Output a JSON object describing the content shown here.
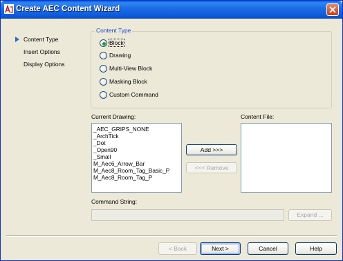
{
  "window": {
    "title": "Create AEC Content Wizard"
  },
  "steps": [
    {
      "label": "Content Type",
      "active": true
    },
    {
      "label": "Insert Options",
      "active": false
    },
    {
      "label": "Display Options",
      "active": false
    }
  ],
  "content_type": {
    "legend": "Content Type",
    "options": [
      {
        "label": "Block",
        "selected": true
      },
      {
        "label": "Drawing",
        "selected": false
      },
      {
        "label": "Multi-View Block",
        "selected": false
      },
      {
        "label": "Masking Block",
        "selected": false
      },
      {
        "label": "Custom Command",
        "selected": false
      }
    ]
  },
  "current_drawing": {
    "label": "Current Drawing:",
    "items": [
      "_AEC_GRIPS_NONE",
      "_ArchTick",
      "_Dot",
      "_Open90",
      "_Small",
      "M_Aec6_Arrow_Bar",
      "M_Aec8_Room_Tag_Basic_P",
      "M_Aec8_Room_Tag_P"
    ]
  },
  "content_file": {
    "label": "Content File:",
    "items": []
  },
  "buttons": {
    "add": "Add >>>",
    "remove": "<<< Remove",
    "expand": "Expand ...",
    "back": "< Back",
    "next": "Next >",
    "cancel": "Cancel",
    "help": "Help"
  },
  "command_string": {
    "label": "Command String:",
    "value": ""
  },
  "colors": {
    "titlebar": "#0a5bd8",
    "accent": "#1f47c8",
    "radio_dot": "#21a121"
  }
}
